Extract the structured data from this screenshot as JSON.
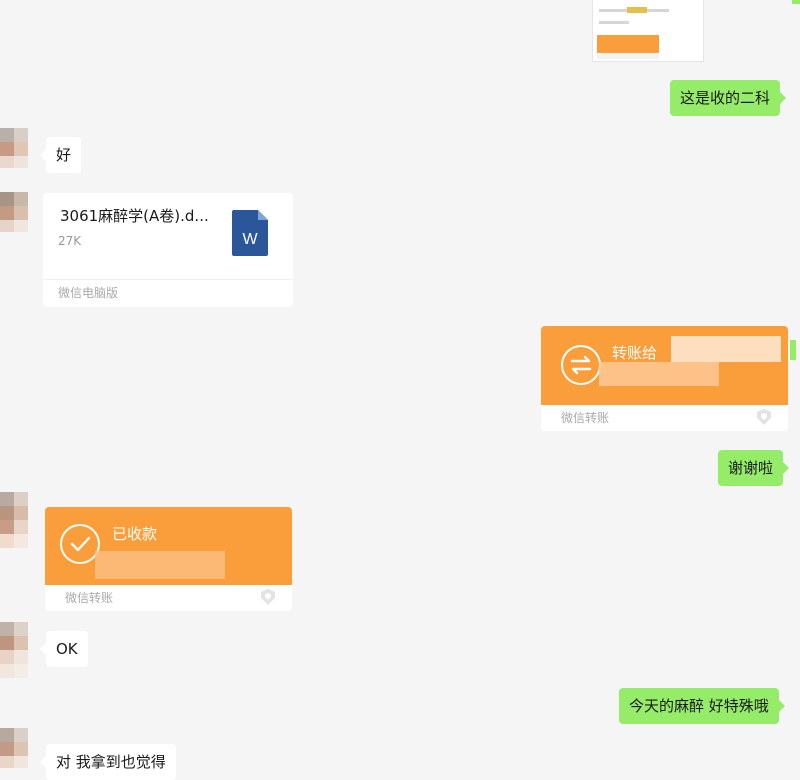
{
  "thumbnail": {},
  "messages": {
    "m1_right": "这是收的二科",
    "m2_left": "好",
    "file": {
      "name": "3061麻醉学(A卷).d...",
      "size": "27K",
      "source": "微信电脑版",
      "icon": "word-doc-icon"
    },
    "transfer_sent": {
      "title": "转账给",
      "footer": "微信转账",
      "icon": "transfer-arrows-icon"
    },
    "m3_right": "谢谢啦",
    "transfer_received": {
      "title": "已收款",
      "footer": "微信转账",
      "icon": "check-circle-icon"
    },
    "m4_left": "OK",
    "m5_right": "今天的麻醉 好特殊哦",
    "m6_left": "对 我拿到也觉得"
  },
  "colors": {
    "background": "#f5f5f5",
    "right_bubble": "#95ec69",
    "transfer": "#fa9d3b"
  }
}
